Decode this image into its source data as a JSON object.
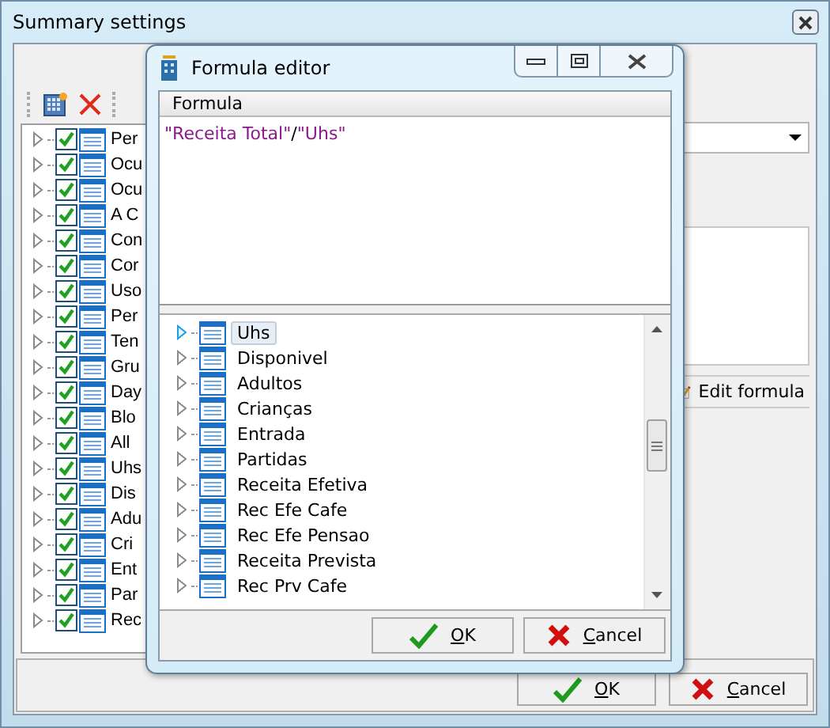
{
  "window": {
    "title": "Summary settings"
  },
  "tree": [
    {
      "label": "Per",
      "checked": true
    },
    {
      "label": "Ocu",
      "checked": true
    },
    {
      "label": "Ocu",
      "checked": true
    },
    {
      "label": "A C",
      "checked": true
    },
    {
      "label": "Con",
      "checked": true
    },
    {
      "label": "Cor",
      "checked": true
    },
    {
      "label": "Uso",
      "checked": true
    },
    {
      "label": "Per",
      "checked": true
    },
    {
      "label": "Ten",
      "checked": true
    },
    {
      "label": "Gru",
      "checked": true
    },
    {
      "label": "Day",
      "checked": true
    },
    {
      "label": "Blo",
      "checked": true
    },
    {
      "label": "All",
      "checked": true
    },
    {
      "label": "Uhs",
      "checked": true
    },
    {
      "label": "Dis",
      "checked": true
    },
    {
      "label": "Adu",
      "checked": true
    },
    {
      "label": "Cri",
      "checked": true
    },
    {
      "label": "Ent",
      "checked": true
    },
    {
      "label": "Par",
      "checked": true
    },
    {
      "label": "Rec",
      "checked": true
    }
  ],
  "edit_formula_button": "Edit formula",
  "buttons": [
    {
      "kind": "ok",
      "label": "OK"
    },
    {
      "kind": "cancel",
      "label": "Cancel"
    }
  ],
  "dialog": {
    "title": "Formula editor",
    "formula_header": "Formula",
    "formula": [
      {
        "kind": "field",
        "text": "\"Receita Total\""
      },
      {
        "kind": "operator",
        "text": "/"
      },
      {
        "kind": "field",
        "text": "\"Uhs\""
      }
    ],
    "fields": [
      {
        "label": "Uhs",
        "selected": true
      },
      {
        "label": "Disponivel",
        "selected": false
      },
      {
        "label": "Adultos",
        "selected": false
      },
      {
        "label": "Crianças",
        "selected": false
      },
      {
        "label": "Entrada",
        "selected": false
      },
      {
        "label": "Partidas",
        "selected": false
      },
      {
        "label": "Receita Efetiva",
        "selected": false
      },
      {
        "label": "Rec Efe Cafe",
        "selected": false
      },
      {
        "label": "Rec Efe Pensao",
        "selected": false
      },
      {
        "label": "Receita Prevista",
        "selected": false
      },
      {
        "label": "Rec Prv Cafe",
        "selected": false
      }
    ],
    "buttons": [
      {
        "kind": "ok",
        "label": "OK"
      },
      {
        "kind": "cancel",
        "label": "Cancel"
      }
    ]
  }
}
